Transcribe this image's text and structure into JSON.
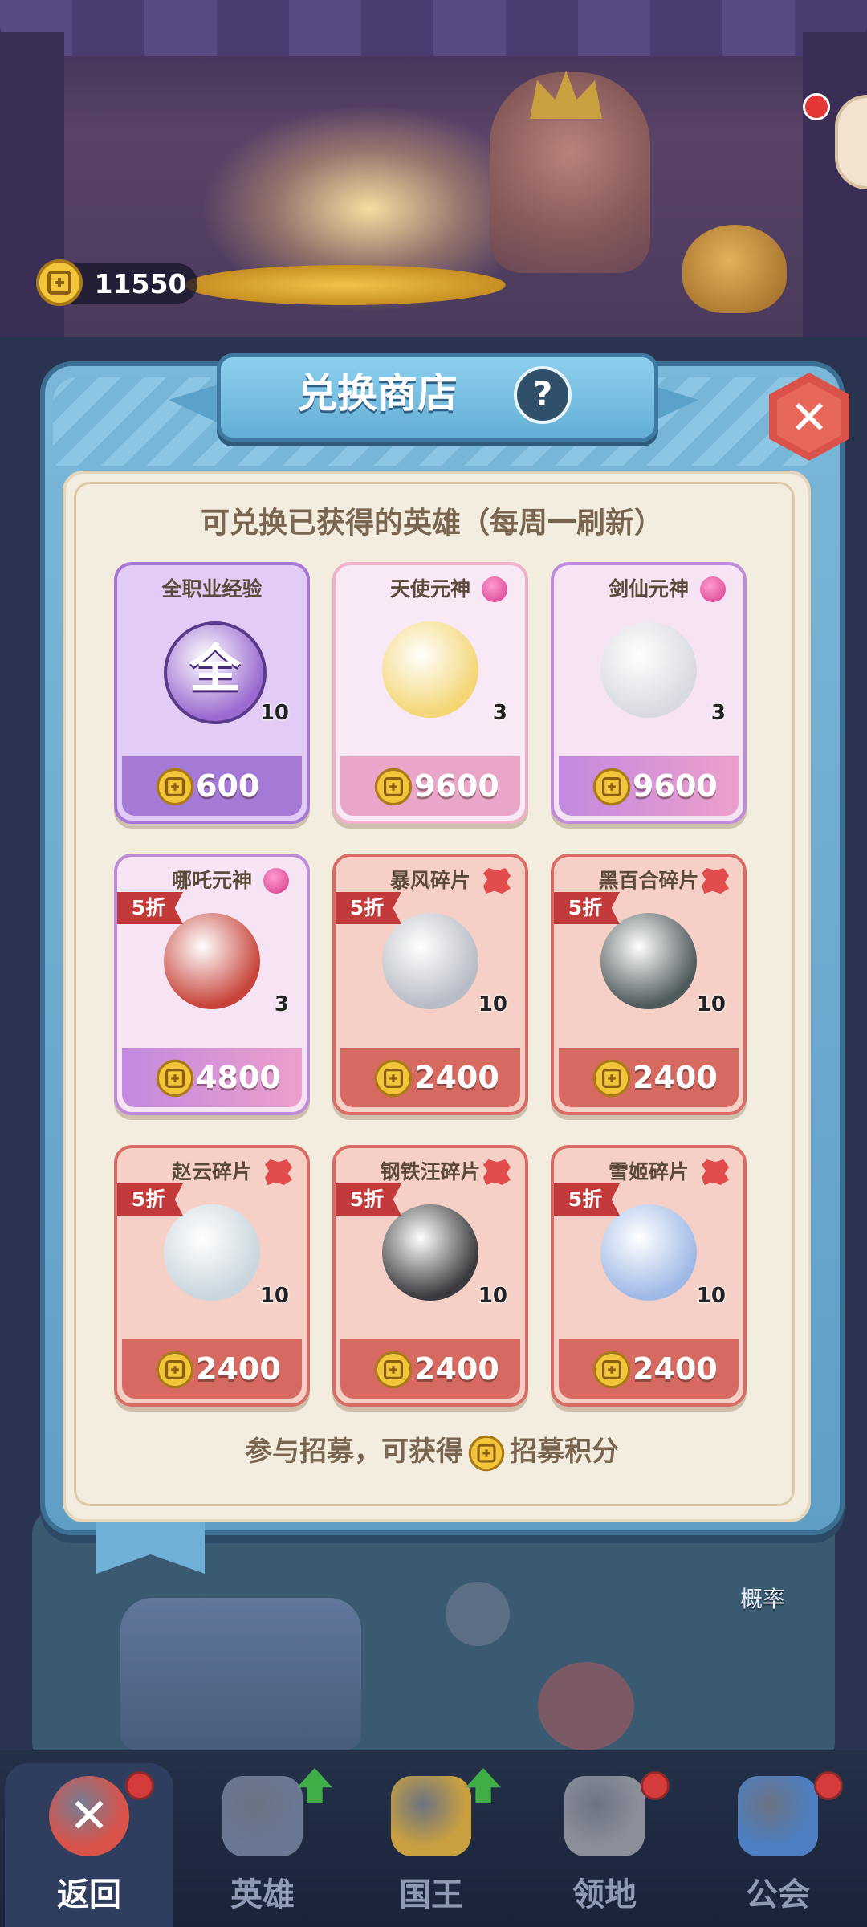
{
  "currency": {
    "value": "11550",
    "icon": "coin-icon"
  },
  "shop": {
    "title": "兑换商店",
    "help": "?",
    "close": "✕",
    "subtitle": "可兑换已获得的英雄（每周一刷新）",
    "footer_before": "参与招募，可获得",
    "footer_after": "招募积分"
  },
  "items": [
    {
      "name": "全职业经验",
      "count": "10",
      "price": "600",
      "style": "purple",
      "badge": "",
      "discount": "",
      "portrait_color": "#9a6ad0",
      "portrait_text": "全"
    },
    {
      "name": "天使元神",
      "count": "3",
      "price": "9600",
      "style": "pink",
      "badge": "gem",
      "discount": "",
      "portrait_color": "#f4d675",
      "portrait_text": ""
    },
    {
      "name": "剑仙元神",
      "count": "3",
      "price": "9600",
      "style": "pinkp",
      "badge": "gem",
      "discount": "",
      "portrait_color": "#d9d9e2",
      "portrait_text": ""
    },
    {
      "name": "哪吒元神",
      "count": "3",
      "price": "4800",
      "style": "pinkp",
      "badge": "gem",
      "discount": "5折",
      "portrait_color": "#c7443a",
      "portrait_text": ""
    },
    {
      "name": "暴风碎片",
      "count": "10",
      "price": "2400",
      "style": "red",
      "badge": "puzzle",
      "discount": "5折",
      "portrait_color": "#b8bcc6",
      "portrait_text": ""
    },
    {
      "name": "黑百合碎片",
      "count": "10",
      "price": "2400",
      "style": "red",
      "badge": "puzzle",
      "discount": "5折",
      "portrait_color": "#4f5a5c",
      "portrait_text": ""
    },
    {
      "name": "赵云碎片",
      "count": "10",
      "price": "2400",
      "style": "red",
      "badge": "puzzle",
      "discount": "5折",
      "portrait_color": "#c9d6de",
      "portrait_text": ""
    },
    {
      "name": "钢铁汪碎片",
      "count": "10",
      "price": "2400",
      "style": "red",
      "badge": "puzzle",
      "discount": "5折",
      "portrait_color": "#3a3a3e",
      "portrait_text": ""
    },
    {
      "name": "雪姬碎片",
      "count": "10",
      "price": "2400",
      "style": "red",
      "badge": "puzzle",
      "discount": "5折",
      "portrait_color": "#9fb9e6",
      "portrait_text": ""
    }
  ],
  "background": {
    "rate_label": "概率"
  },
  "nav": [
    {
      "label": "返回",
      "icon": "close-icon",
      "active": true,
      "dot": true,
      "arrow": false
    },
    {
      "label": "英雄",
      "icon": "helmet-icon",
      "active": false,
      "dot": false,
      "arrow": true
    },
    {
      "label": "国王",
      "icon": "crown-icon",
      "active": false,
      "dot": false,
      "arrow": true
    },
    {
      "label": "领地",
      "icon": "castle-icon",
      "active": false,
      "dot": true,
      "arrow": false
    },
    {
      "label": "公会",
      "icon": "planet-icon",
      "active": false,
      "dot": true,
      "arrow": false
    }
  ]
}
